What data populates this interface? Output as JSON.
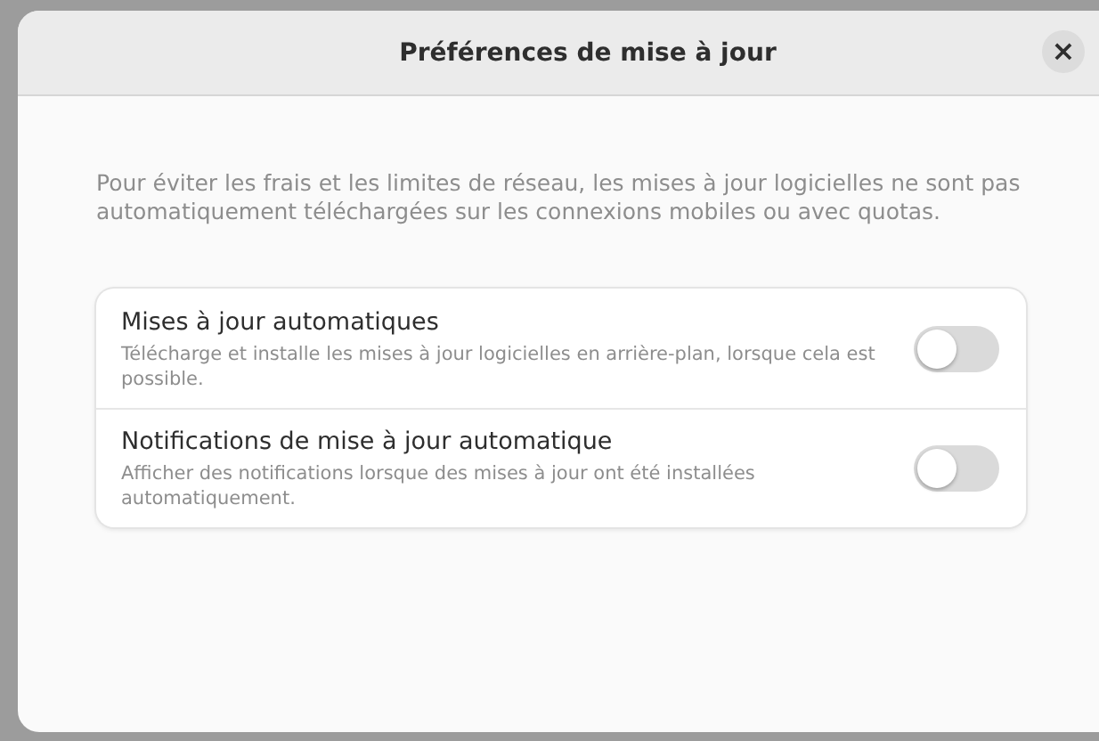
{
  "window": {
    "title": "Préférences de mise à jour",
    "close": "×"
  },
  "description": "Pour éviter les frais et les limites de réseau, les mises à jour logicielles ne sont pas automatiquement téléchargées sur les connexions mobiles ou avec quotas.",
  "settings": [
    {
      "title": "Mises à jour automatiques",
      "subtitle": "Télécharge et installe les mises à jour logicielles en arrière-plan, lorsque cela est possible.",
      "on": false
    },
    {
      "title": "Notifications de mise à jour automatique",
      "subtitle": "Afficher des notifications lorsque des mises à jour ont été installées automatiquement.",
      "on": false
    }
  ]
}
